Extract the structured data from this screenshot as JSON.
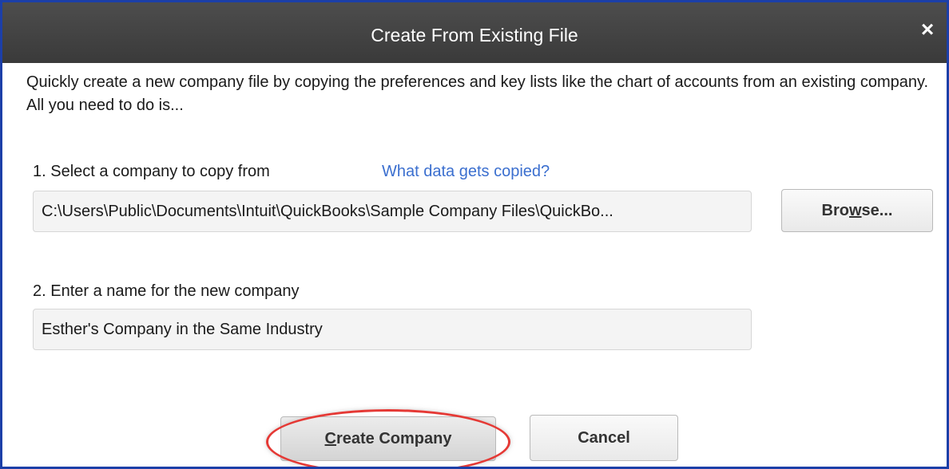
{
  "dialog": {
    "title": "Create From Existing File",
    "close_glyph": "×"
  },
  "intro_text": "Quickly create a new company file by copying the preferences and key lists like the chart of accounts from an existing company. All you need to do is...",
  "step1": {
    "label": "1. Select a company to copy from",
    "help_link": "What data gets copied?",
    "path_value": "C:\\Users\\Public\\Documents\\Intuit\\QuickBooks\\Sample Company Files\\QuickBo...",
    "browse_label_before": "Bro",
    "browse_label_mnemonic": "w",
    "browse_label_after": "se..."
  },
  "step2": {
    "label": "2. Enter a name for the new company",
    "company_name_value": "Esther's Company in the Same Industry"
  },
  "buttons": {
    "create_mnemonic": "C",
    "create_rest": "reate Company",
    "cancel": "Cancel"
  },
  "colors": {
    "titlebar": "#3a3a3a",
    "link": "#3b6fcf",
    "highlight_ring": "#e53935",
    "window_border": "#1c3fa8"
  }
}
